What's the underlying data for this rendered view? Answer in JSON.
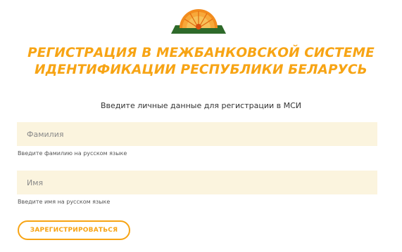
{
  "header": {
    "logo_icon": "orange-sunburst-logo-icon",
    "title_line1": "РЕГИСТРАЦИЯ В МЕЖБАНКОВСКОЙ СИСТЕМЕ",
    "title_line2": "ИДЕНТИФИКАЦИИ РЕСПУБЛИКИ БЕЛАРУСЬ"
  },
  "form": {
    "intro": "Введите личные данные для регистрации в МСИ",
    "surname": {
      "placeholder": "Фамилия",
      "value": "",
      "hint": "Введите фамилию на русском языке"
    },
    "name": {
      "placeholder": "Имя",
      "value": "",
      "hint": "Введите имя на русском языке"
    },
    "submit_label": "ЗАРЕГИСТРИРОВАТЬСЯ"
  },
  "colors": {
    "accent": "#F7A414",
    "field_background": "#FBF4DE",
    "logo_green": "#2E6A2A",
    "logo_orange": "#F28C1E"
  }
}
